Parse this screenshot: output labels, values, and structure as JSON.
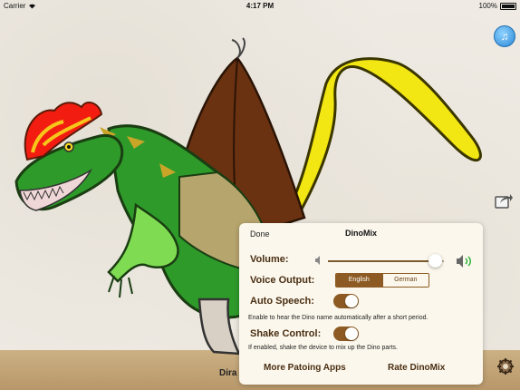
{
  "status_bar": {
    "carrier": "Carrier",
    "time": "4:17 PM",
    "battery": "100%"
  },
  "icons": {
    "music": "music-note-icon",
    "share": "share-icon",
    "gear": "gear-icon",
    "wifi": "wifi-icon"
  },
  "bottom_label": "Dira",
  "settings": {
    "done_label": "Done",
    "title": "DinoMix",
    "volume_label": "Volume:",
    "volume_level": 0.92,
    "voice_output_label": "Voice Output:",
    "voice_options": [
      "English",
      "German"
    ],
    "voice_selected": "English",
    "auto_speech_label": "Auto Speech:",
    "auto_speech_on": true,
    "auto_speech_hint": "Enable to hear the Dino name automatically after a short period.",
    "shake_control_label": "Shake Control:",
    "shake_control_on": true,
    "shake_control_hint": "If enabled, shake the device to mix up the Dino parts.",
    "more_apps_label": "More Patoing Apps",
    "rate_label": "Rate DinoMix"
  },
  "colors": {
    "accent": "#8c5a22",
    "panel_bg": "#fbf7ec",
    "label": "#4a2e12"
  }
}
